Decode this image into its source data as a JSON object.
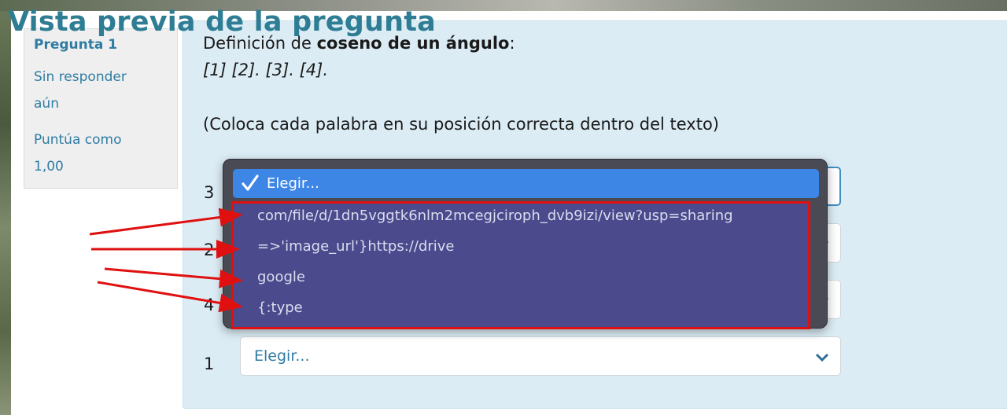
{
  "page": {
    "title": "Vista previa de la pregunta"
  },
  "info": {
    "question_number": "Pregunta 1",
    "state": "Sin responder aún",
    "state_line1": "Sin responder",
    "state_line2": "aún",
    "grade_line1": "Puntúa como",
    "grade_line2": "1,00"
  },
  "question": {
    "intro_prefix": "Definición de ",
    "intro_bold": "coseno de un ángulo",
    "intro_suffix": ":",
    "slots": "[1] [2]. [3]. [4].",
    "instruction": "(Coloca cada palabra en su posición correcta dentro del texto)"
  },
  "rows": [
    {
      "number": "3",
      "selected": "Elegir..."
    },
    {
      "number": "2",
      "selected": "Elegir..."
    },
    {
      "number": "4",
      "selected": "Elegir..."
    },
    {
      "number": "1",
      "selected": "Elegir..."
    }
  ],
  "dropdown": {
    "selected_label": "Elegir...",
    "options": [
      "com/file/d/1dn5vggtk6nlm2mcegjciroph_dvb9izi/view?usp=sharing",
      "=>'image_url'}https://drive",
      "google",
      "{:type"
    ]
  },
  "colors": {
    "title": "#2e7d94",
    "link": "#2f7ca3",
    "highlight": "#3d86e6",
    "annotation": "#e01010"
  }
}
